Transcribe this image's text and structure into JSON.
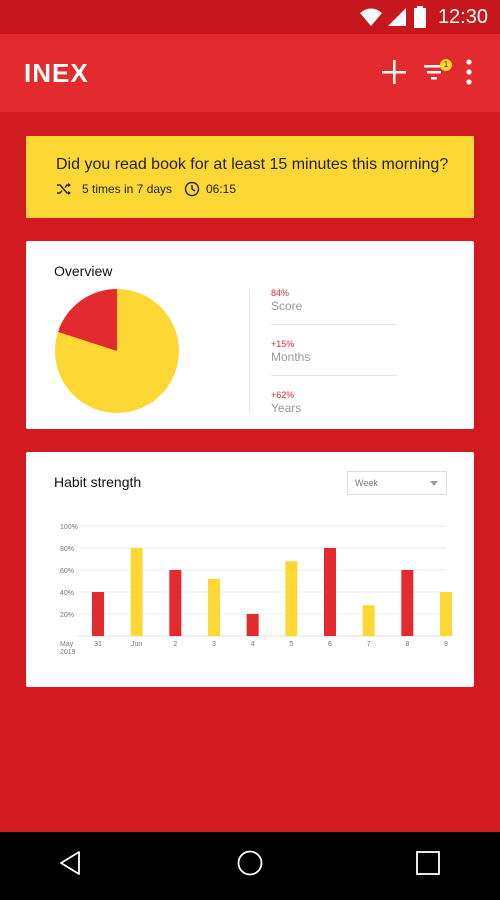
{
  "status_bar": {
    "time": "12:30",
    "icons": [
      "wifi-icon",
      "signal-icon",
      "battery-icon"
    ]
  },
  "app_bar": {
    "logo": "INEX",
    "filter_badge": "1",
    "actions": [
      "plus-icon",
      "filter-icon",
      "more-vert-icon"
    ]
  },
  "question": {
    "text": "Did you read book for at least 15 minutes this morning?",
    "frequency": "5 times in 7 days",
    "time": "06:15"
  },
  "overview": {
    "title": "Overview",
    "pie_fraction_yellow": 0.8,
    "stats": [
      {
        "value": "84%",
        "label": "Score"
      },
      {
        "value": "+15%",
        "label": "Months"
      },
      {
        "value": "+62%",
        "label": "Years"
      }
    ]
  },
  "habit_strength": {
    "title": "Habit strength",
    "select": {
      "selected": "Week"
    }
  },
  "chart_data": {
    "type": "bar",
    "categories": [
      "31",
      "Jun",
      "2",
      "3",
      "4",
      "5",
      "6",
      "7",
      "8",
      "9"
    ],
    "x_sublabel": [
      "May",
      "2019"
    ],
    "values": [
      40,
      80,
      60,
      52,
      20,
      68,
      80,
      28,
      60,
      40
    ],
    "bar_colors": [
      "#e22a2f",
      "#fdd835",
      "#e22a2f",
      "#fdd835",
      "#e22a2f",
      "#fdd835",
      "#e22a2f",
      "#fdd835",
      "#e22a2f",
      "#fdd835"
    ],
    "y_ticks": [
      "100%",
      "80%",
      "60%",
      "40%",
      "20%"
    ],
    "ylim": [
      0,
      100
    ],
    "grid": true
  },
  "colors": {
    "brand_red": "#d21a21",
    "appbar_red": "#e22a2f",
    "accent_yellow": "#fdd835"
  },
  "nav_bar": {
    "icons": [
      "back-icon",
      "home-icon",
      "recents-icon"
    ]
  }
}
